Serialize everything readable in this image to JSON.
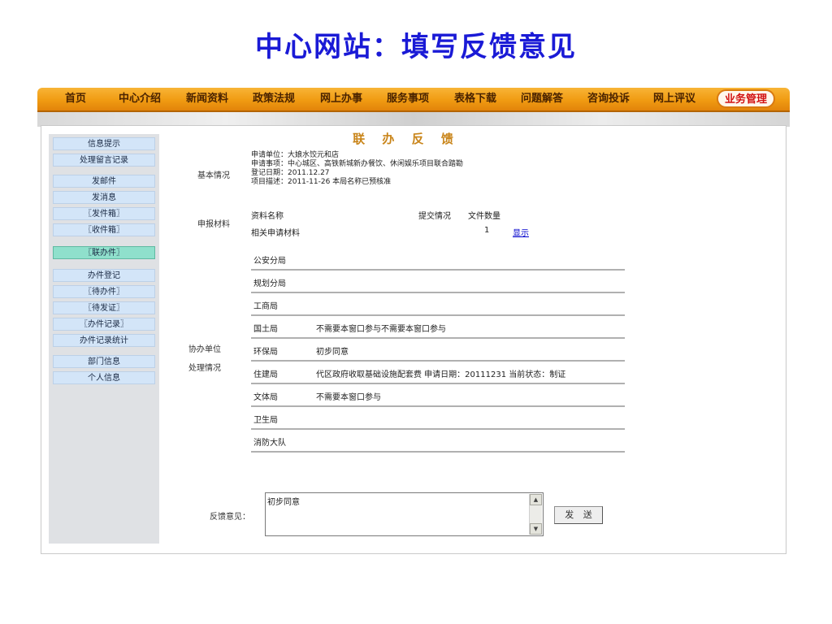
{
  "title": "中心网站：填写反馈意见",
  "nav": [
    "首页",
    "中心介绍",
    "新闻资料",
    "政策法规",
    "网上办事",
    "服务事项",
    "表格下载",
    "问题解答",
    "咨询投诉",
    "网上评议",
    "业务管理"
  ],
  "sidebar": [
    "信息提示",
    "处理留言记录",
    "发邮件",
    "发消息",
    "〖发件箱〗",
    "〖收件箱〗",
    "〖联办件〗",
    "办件登记",
    "〖待办件〗",
    "〖待发证〗",
    "〖办件记录〗",
    "办件记录统计",
    "部门信息",
    "个人信息"
  ],
  "content": {
    "heading": "联 办 反 馈",
    "basic_label": "基本情况",
    "basic": {
      "unit": "申请单位：大娘水饺元和店",
      "item": "申请事项：中心城区、高铁新城新办餐饮、休闲娱乐项目联合踏勘",
      "date": "登记日期：2011.12.27",
      "desc": "项目描述：2011-11-26 本局名称已预核准"
    },
    "materials_label": "申报材料",
    "materials": {
      "col_name": "资料名称",
      "col_status": "提交情况",
      "col_count": "文件数量",
      "row_name": "相关申请材料",
      "row_count": "1",
      "row_link": "显示"
    },
    "agencies_label1": "协办单位",
    "agencies_label2": "处理情况",
    "agencies": [
      {
        "name": "公安分局",
        "note": ""
      },
      {
        "name": "规划分局",
        "note": ""
      },
      {
        "name": "工商局",
        "note": ""
      },
      {
        "name": "国土局",
        "note": "不需要本窗口参与不需要本窗口参与"
      },
      {
        "name": "环保局",
        "note": "初步同意"
      },
      {
        "name": "住建局",
        "note": "代区政府收取基础设施配套费  申请日期：20111231 当前状态：制证"
      },
      {
        "name": "文体局",
        "note": "不需要本窗口参与"
      },
      {
        "name": "卫生局",
        "note": ""
      },
      {
        "name": "消防大队",
        "note": ""
      }
    ],
    "feedback_label": "反馈意见：",
    "feedback_value": "初步同意",
    "send_label": "发 送"
  }
}
